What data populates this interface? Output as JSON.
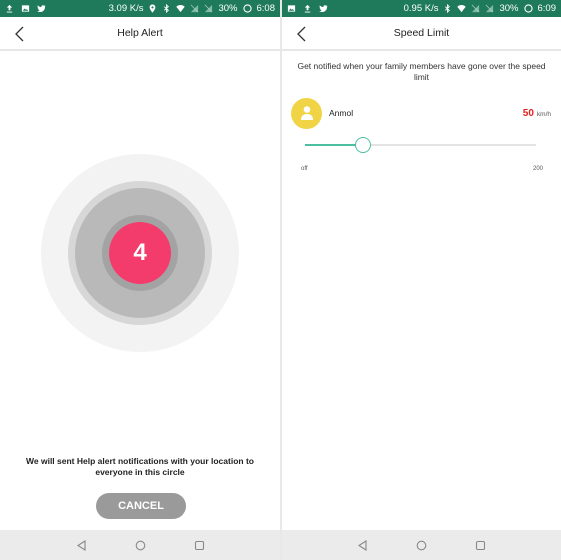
{
  "left": {
    "status": {
      "speed": "3.09 K/s",
      "battery": "30%",
      "time": "6:08"
    },
    "title": "Help Alert",
    "countdown": "4",
    "message": "We will sent Help alert notifications with your location to everyone in this circle",
    "cancel_label": "CANCEL"
  },
  "right": {
    "status": {
      "speed": "0.95 K/s",
      "battery": "30%",
      "time": "6:09"
    },
    "title": "Speed Limit",
    "description": "Get notified when your family members have gone over the speed limit",
    "member": {
      "name": "Anmol",
      "speed": "50",
      "unit": "km/h"
    },
    "slider": {
      "min_label": "off",
      "max_label": "200",
      "value": 50,
      "max": 200
    }
  },
  "colors": {
    "status_bar": "#1f7a5c",
    "alert_accent": "#f43c6c",
    "slider_accent": "#4cbfa0",
    "speed_value": "#e02020",
    "avatar": "#f1d446"
  }
}
